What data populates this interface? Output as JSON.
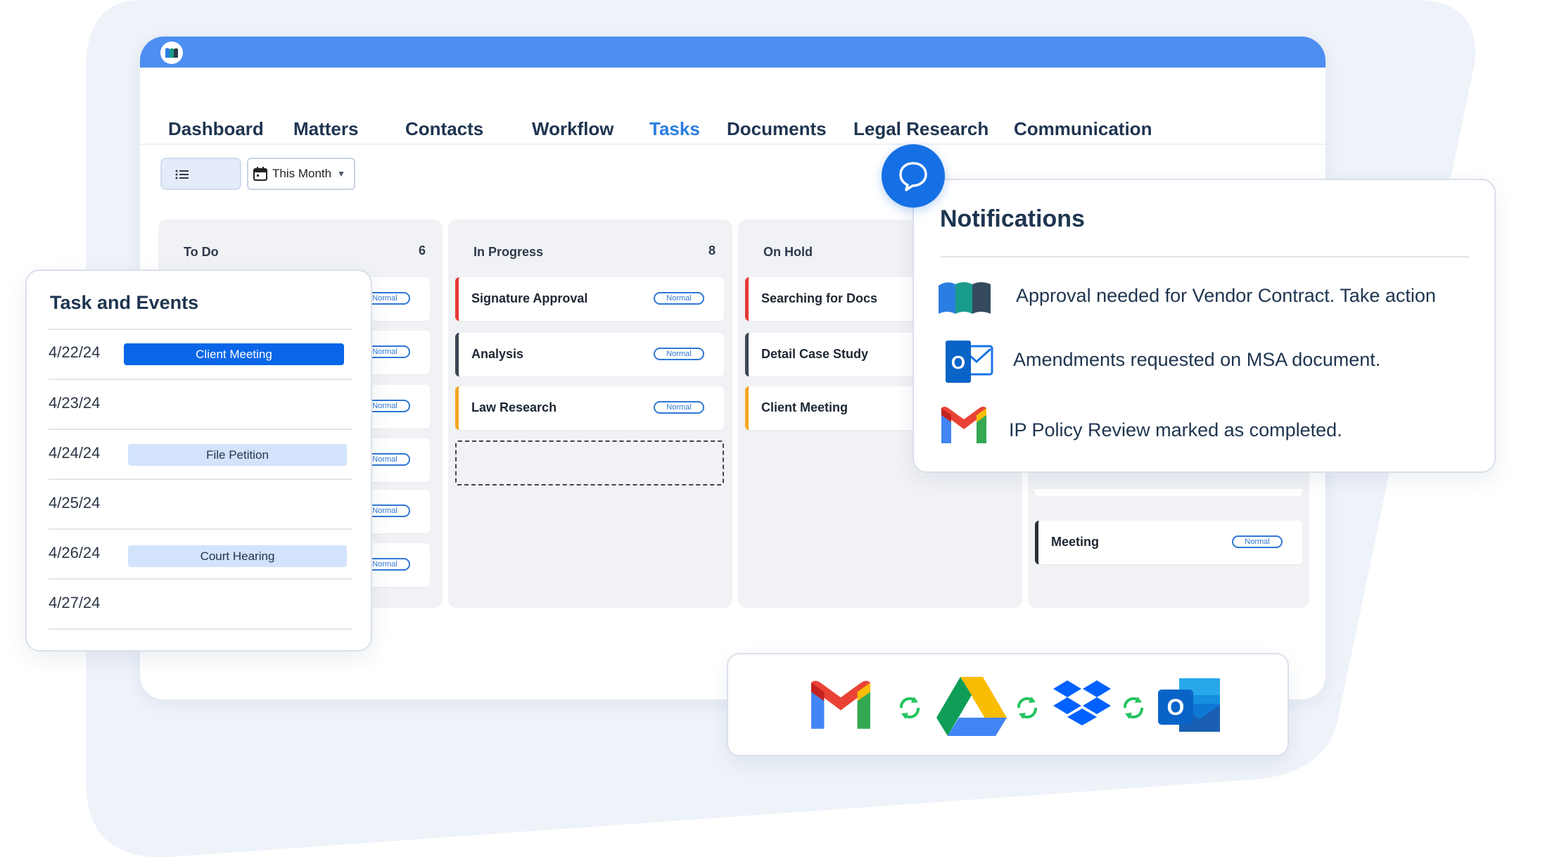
{
  "nav": {
    "items": [
      {
        "label": "Dashboard",
        "active": false
      },
      {
        "label": "Matters",
        "active": false
      },
      {
        "label": "Contacts",
        "active": false
      },
      {
        "label": "Workflow",
        "active": false
      },
      {
        "label": "Tasks",
        "active": true
      },
      {
        "label": "Documents",
        "active": false
      },
      {
        "label": "Legal Research",
        "active": false
      },
      {
        "label": "Communication",
        "active": false
      }
    ]
  },
  "toolbar": {
    "date_filter": "This Month"
  },
  "board": {
    "columns": [
      {
        "title": "To Do",
        "count": "6",
        "cards": [
          {
            "badge": "Normal"
          },
          {
            "badge": "Normal"
          },
          {
            "badge": "Normal"
          },
          {
            "badge": "Normal"
          },
          {
            "badge": "Normal"
          },
          {
            "badge": "Normal"
          }
        ]
      },
      {
        "title": "In Progress",
        "count": "8",
        "cards": [
          {
            "title": "Signature Approval",
            "badge": "Normal",
            "color": "#e53935"
          },
          {
            "title": "Analysis",
            "badge": "Normal",
            "color": "#3c4654"
          },
          {
            "title": "Law Research",
            "badge": "Normal",
            "color": "#f5a623"
          }
        ]
      },
      {
        "title": "On Hold",
        "cards": [
          {
            "title": "Searching for Docs",
            "color": "#e53935"
          },
          {
            "title": "Detail Case Study",
            "color": "#3c4654"
          },
          {
            "title": "Client Meeting",
            "color": "#f5a623"
          }
        ]
      },
      {
        "title": "",
        "cards": [
          {
            "title": "Meeting",
            "badge": "Normal",
            "color": "#2b2f36"
          }
        ]
      }
    ]
  },
  "tasks_panel": {
    "title": "Task and Events",
    "rows": [
      {
        "date": "4/22/24",
        "event": "Client Meeting",
        "style": "primary"
      },
      {
        "date": "4/23/24",
        "event": ""
      },
      {
        "date": "4/24/24",
        "event": "File Petition",
        "style": "light"
      },
      {
        "date": "4/25/24",
        "event": ""
      },
      {
        "date": "4/26/24",
        "event": "Court Hearing",
        "style": "light"
      },
      {
        "date": "4/27/24",
        "event": ""
      }
    ]
  },
  "notifications": {
    "title": "Notifications",
    "items": [
      {
        "icon": "app-logo-icon",
        "text": "Approval needed for Vendor Contract. Take action"
      },
      {
        "icon": "outlook-icon",
        "text": "Amendments requested on MSA document."
      },
      {
        "icon": "gmail-icon",
        "text": "IP Policy Review marked as completed."
      }
    ]
  },
  "integrations": {
    "icons": [
      "gmail-icon",
      "sync-icon",
      "google-drive-icon",
      "sync-icon",
      "dropbox-icon",
      "sync-icon",
      "outlook-icon"
    ]
  },
  "colors": {
    "brand_blue": "#4c8ef2",
    "active_tab": "#2a7de1",
    "event_primary": "#0a66e8",
    "event_light": "#d2e3fb",
    "sync_green": "#22c55e"
  }
}
